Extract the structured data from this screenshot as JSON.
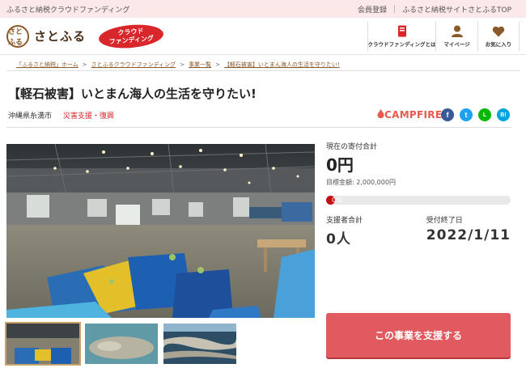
{
  "topbar": {
    "tagline": "ふるさと納税クラウドファンディング",
    "links": [
      "会員登録",
      "ふるさと納税サイトさとふるTOP"
    ]
  },
  "header": {
    "logo_mark": "さと ふる",
    "logo_text": "さとふる",
    "cf_badge_line1": "クラウド",
    "cf_badge_line2": "ファンディング",
    "nav": [
      {
        "label": "クラウドファンディングとは",
        "icon": "book-icon"
      },
      {
        "label": "マイページ",
        "icon": "person-icon"
      },
      {
        "label": "お気に入り",
        "icon": "heart-icon"
      }
    ]
  },
  "breadcrumbs": [
    "「ふるさと納税」ホーム",
    "さとふるクラウドファンディング",
    "事業一覧",
    "【軽石被害】いとまん海人の生活を守りたい!"
  ],
  "project": {
    "title": "【軽石被害】いとまん海人の生活を守りたい!",
    "location": "沖縄県糸満市",
    "category": "災害支援・復興",
    "partner": "CAMPFIRE"
  },
  "socials": [
    {
      "name": "facebook-icon",
      "glyph": "f",
      "color": "#3b5998"
    },
    {
      "name": "twitter-icon",
      "glyph": "t",
      "color": "#1da1f2"
    },
    {
      "name": "line-icon",
      "glyph": "L",
      "color": "#00b900"
    },
    {
      "name": "hatena-icon",
      "glyph": "B!",
      "color": "#00a4de"
    }
  ],
  "stats": {
    "current_label": "現在の寄付合計",
    "current_amount": "0円",
    "goal": "目標金額: 2,000,000円",
    "progress_text": "0%",
    "progress": 0,
    "supporters_label": "支援者合計",
    "supporters": "0人",
    "deadline_label": "受付終了日",
    "deadline": "2022/1/11"
  },
  "cta": {
    "label": "この事業を支援する"
  },
  "colors": {
    "accent": "#d9262b",
    "button": "#e05a60",
    "brown": "#8b5a2b"
  }
}
